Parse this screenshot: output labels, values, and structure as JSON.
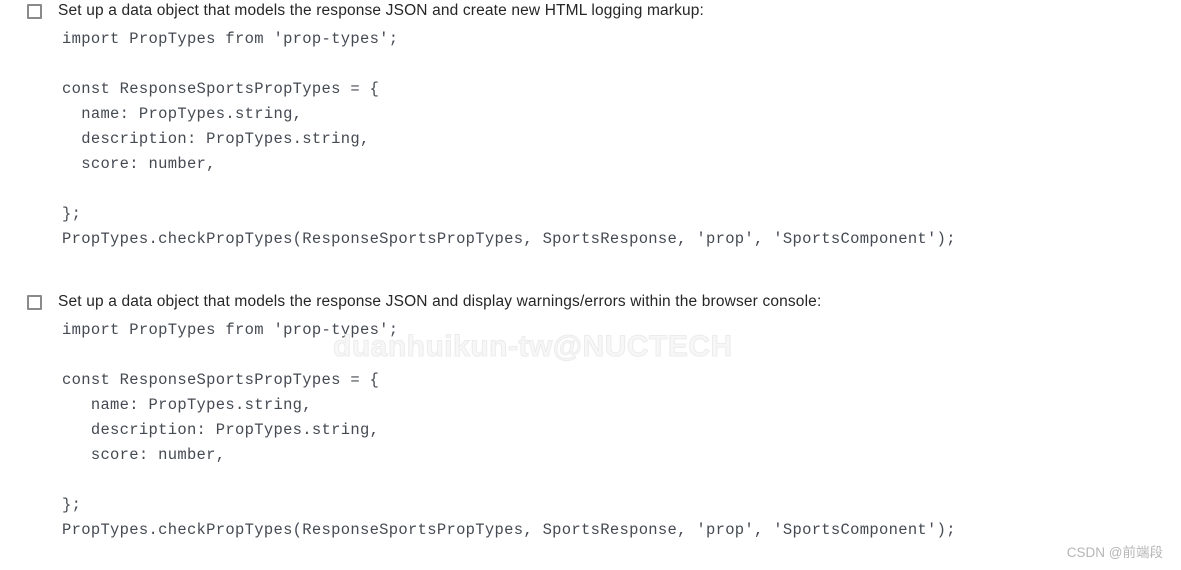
{
  "page": {
    "background_color": "#ffffff",
    "text_color": "#262626",
    "code_color": "#454a52",
    "string_color": "#3b4b8f",
    "checkbox_border_color": "#8a8a8a"
  },
  "tasks": [
    {
      "checkbox_state": "unchecked",
      "heading": "Set up a data object that models the response JSON and create new HTML logging markup:",
      "code": "import PropTypes from 'prop-types';\n\nconst ResponseSportsPropTypes = {\n  name: PropTypes.string,\n  description: PropTypes.string,\n  score: number,\n\n};\nPropTypes.checkPropTypes(ResponseSportsPropTypes, SportsResponse, 'prop', 'SportsComponent');"
    },
    {
      "checkbox_state": "unchecked",
      "heading": "Set up a data object that models the response JSON and display warnings/errors within the browser console:",
      "code": "import PropTypes from 'prop-types';\n\nconst ResponseSportsPropTypes = {\n   name: PropTypes.string,\n   description: PropTypes.string,\n   score: number,\n\n};\nPropTypes.checkPropTypes(ResponseSportsPropTypes, SportsResponse, 'prop', 'SportsComponent');"
    }
  ],
  "watermark": {
    "text": "duanhuikun-tw@NUCTECH",
    "color": "#f2f2f2"
  },
  "credit": {
    "text": "CSDN @前端段",
    "color": "#b6b6b6"
  }
}
